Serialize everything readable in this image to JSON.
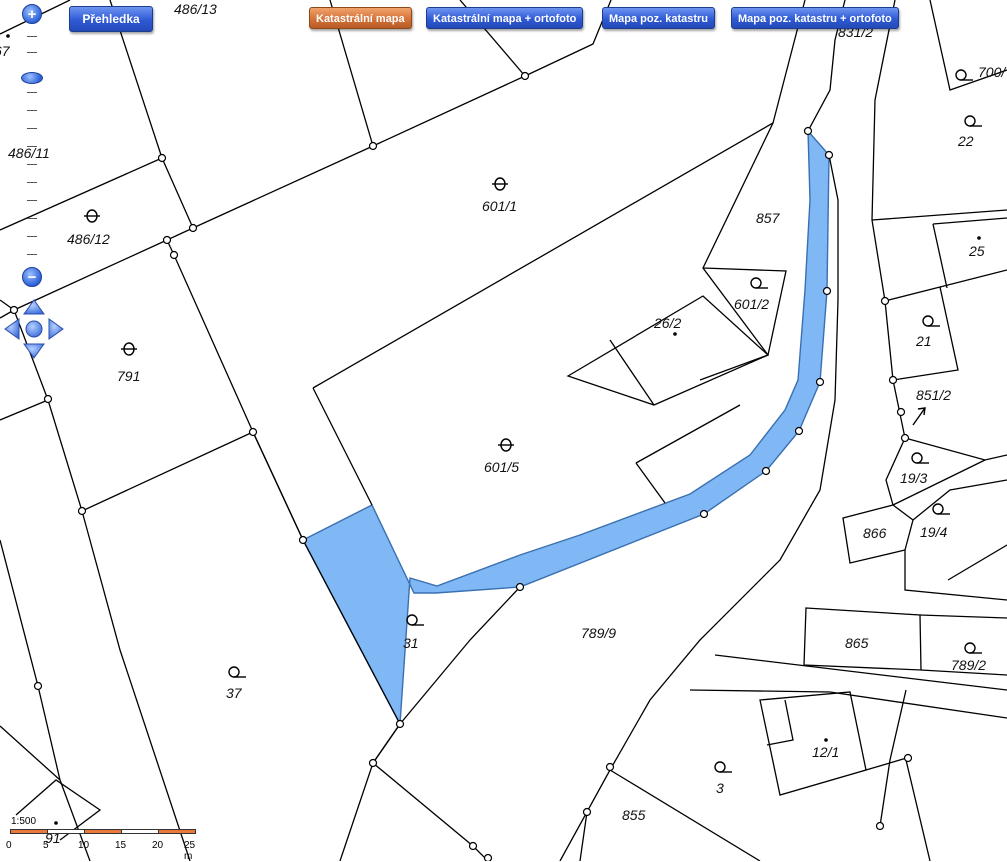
{
  "toolbar": {
    "overview_label": "Přehledka",
    "layers": [
      "Katastrální mapa",
      "Katastrální mapa + ortofoto",
      "Mapa poz. katastru",
      "Mapa poz. katastru + ortofoto"
    ],
    "active_layer": "Katastrální mapa"
  },
  "zoom": {
    "plus_label": "+",
    "minus_label": "−"
  },
  "parcels": {
    "p486_13": "486/13",
    "p67": "67",
    "p486_11": "486/11",
    "p486_12": "486/12",
    "p791": "791",
    "p601_1": "601/1",
    "p601_5": "601/5",
    "p601_2": "601/2",
    "p26_2": "26/2",
    "p857": "857",
    "p831_2": "831/2",
    "p700": "700/",
    "p22": "22",
    "p25": "25",
    "p21": "21",
    "p851_2": "851/2",
    "p19_3": "19/3",
    "p19_4": "19/4",
    "p866": "866",
    "p865": "865",
    "p789_2": "789/2",
    "p789_9": "789/9",
    "p31": "31",
    "p37": "37",
    "p12_1": "12/1",
    "p3": "3",
    "p855": "855",
    "p91": "91"
  },
  "scale": {
    "ratio": "1:500",
    "ticks": [
      "0",
      "5",
      "10",
      "15",
      "20",
      "25 m"
    ]
  },
  "colors": {
    "highlight_fill": "#7fb8f5",
    "active_button": "#d5733a",
    "button": "#2f5ad6"
  }
}
